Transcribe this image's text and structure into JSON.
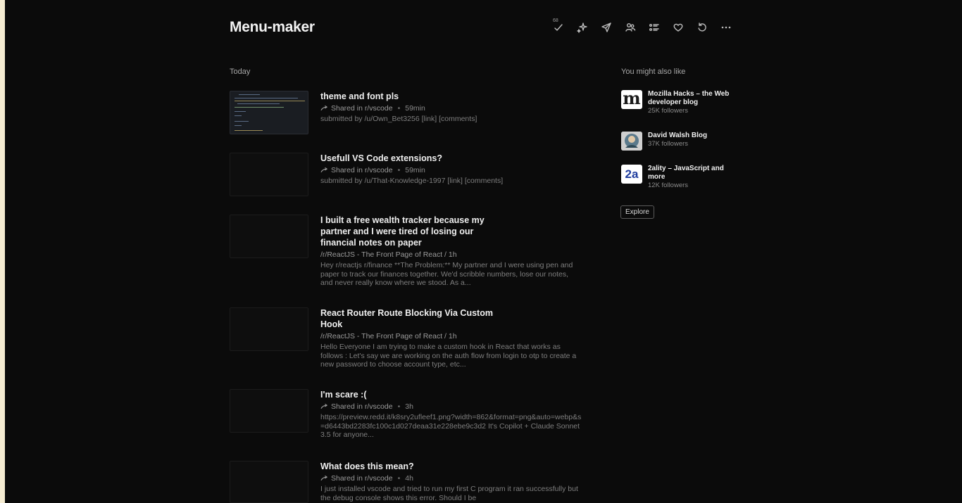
{
  "app": {
    "title": "Menu-maker"
  },
  "toolbar": {
    "badge": "68",
    "buttons": [
      "mark-all-read",
      "sparkle",
      "send",
      "people",
      "list",
      "heart",
      "refresh",
      "more"
    ]
  },
  "feed": {
    "section": "Today",
    "entries": [
      {
        "title": "theme and font pls",
        "source": "Shared in r/vscode",
        "time": "59min",
        "snippet": "submitted by /u/Own_Bet3256 [link] [comments]",
        "shared": true
      },
      {
        "title": "Usefull VS Code extensions?",
        "source": "Shared in r/vscode",
        "time": "59min",
        "snippet": "submitted by /u/That-Knowledge-1997 [link] [comments]",
        "shared": true
      },
      {
        "title": "I built a free wealth tracker because my partner and I were tired of losing our financial notes on paper",
        "source": "/r/ReactJS - The Front Page of React / 1h",
        "time": "",
        "snippet": "Hey r/reactjs r/finance **The Problem:** My partner and I were using pen and paper to track our finances together. We'd scribble numbers, lose our notes, and never really know where we stood. As a...",
        "shared": false
      },
      {
        "title": "React Router Route Blocking Via Custom Hook",
        "source": "/r/ReactJS - The Front Page of React / 1h",
        "time": "",
        "snippet": "Hello Everyone I am trying to make a custom hook in React that works as follows : Let's say we are working on the auth flow from login to otp to create a new password to choose account type, etc...",
        "shared": false
      },
      {
        "title": "I'm scare :(",
        "source": "Shared in r/vscode",
        "time": "3h",
        "snippet": "https://preview.redd.it/k8sry2ufleef1.png?width=862&format=png&auto=webp&s=d6443bd2283fc100c1d027deaa31e228ebe9c3d2 It's Copilot + Claude Sonnet 3.5 for anyone...",
        "shared": true
      },
      {
        "title": "What does this mean?",
        "source": "Shared in r/vscode",
        "time": "4h",
        "snippet": "I just installed vscode and tried to run my first C program it ran successfully but the debug console shows this error. Should I be",
        "shared": true
      }
    ]
  },
  "sidebar": {
    "heading": "You might also like",
    "suggestions": [
      {
        "name": "Mozilla Hacks – the Web developer blog",
        "followers": "25K followers",
        "logo": "m"
      },
      {
        "name": "David Walsh Blog",
        "followers": "37K followers",
        "logo": "david-walsh-avatar"
      },
      {
        "name": "2ality – JavaScript and more",
        "followers": "12K followers",
        "logo": "2a"
      }
    ],
    "explore": "Explore"
  }
}
